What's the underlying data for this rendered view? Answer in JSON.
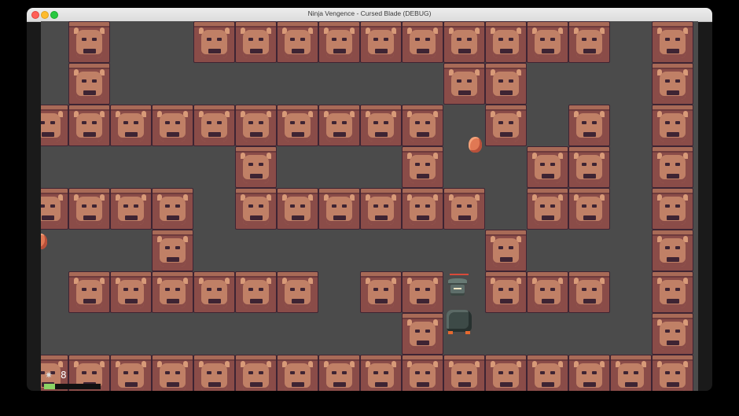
{
  "window": {
    "title": "Ninja Vengence - Cursed Blade (DEBUG)"
  },
  "hud": {
    "shuriken_icon": "shuriken-icon",
    "shuriken_count": "8",
    "xp_progress": 0.2
  },
  "colors": {
    "floor": "#4b4b4b",
    "wall": "#8a4c48",
    "enemy": "#e07854",
    "xp_bar": "#8ad464",
    "health_bar": "#d84a3a"
  }
}
